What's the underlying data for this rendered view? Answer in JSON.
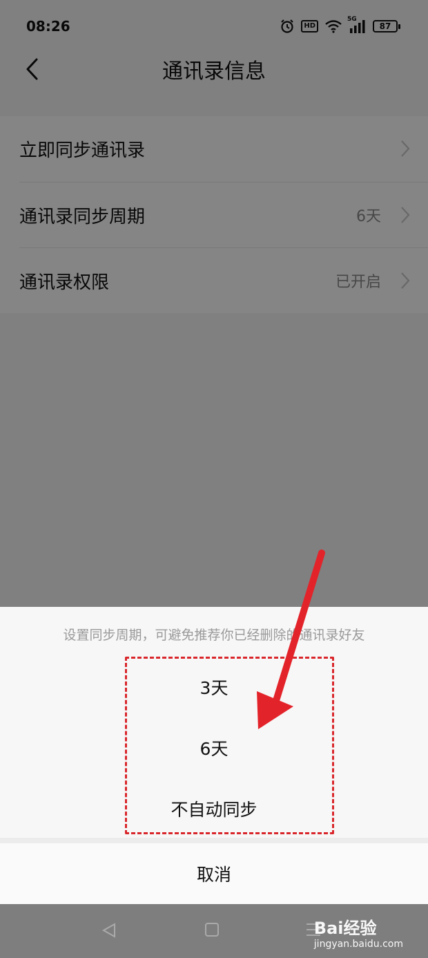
{
  "statusbar": {
    "time": "08:26",
    "hd": "HD",
    "network": "5G",
    "battery": "87"
  },
  "navbar": {
    "title": "通讯录信息",
    "back_icon": "chevron-left-icon"
  },
  "settings": {
    "rows": [
      {
        "label": "立即同步通讯录",
        "value": ""
      },
      {
        "label": "通讯录同步周期",
        "value": "6天"
      },
      {
        "label": "通讯录权限",
        "value": "已开启"
      }
    ]
  },
  "sheet": {
    "hint": "设置同步周期，可避免推荐你已经删除的通讯录好友",
    "options": [
      "3天",
      "6天",
      "不自动同步"
    ],
    "cancel": "取消"
  },
  "watermark": {
    "logo": "Bai经验",
    "sub": "jingyan.baidu.com"
  },
  "colors": {
    "annotation_red": "#d9262b",
    "overlay": "#7f7f7f"
  }
}
